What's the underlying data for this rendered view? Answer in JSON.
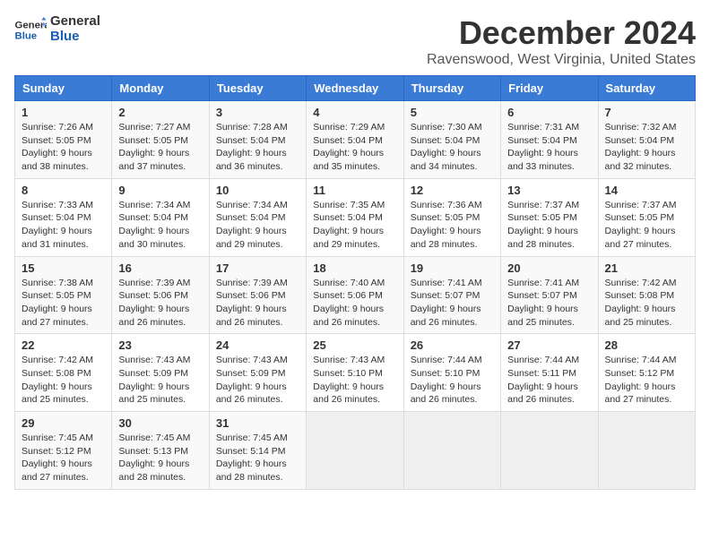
{
  "logo": {
    "line1": "General",
    "line2": "Blue"
  },
  "title": "December 2024",
  "location": "Ravenswood, West Virginia, United States",
  "days_of_week": [
    "Sunday",
    "Monday",
    "Tuesday",
    "Wednesday",
    "Thursday",
    "Friday",
    "Saturday"
  ],
  "weeks": [
    [
      {
        "day": "1",
        "sunrise": "Sunrise: 7:26 AM",
        "sunset": "Sunset: 5:05 PM",
        "daylight": "Daylight: 9 hours and 38 minutes."
      },
      {
        "day": "2",
        "sunrise": "Sunrise: 7:27 AM",
        "sunset": "Sunset: 5:05 PM",
        "daylight": "Daylight: 9 hours and 37 minutes."
      },
      {
        "day": "3",
        "sunrise": "Sunrise: 7:28 AM",
        "sunset": "Sunset: 5:04 PM",
        "daylight": "Daylight: 9 hours and 36 minutes."
      },
      {
        "day": "4",
        "sunrise": "Sunrise: 7:29 AM",
        "sunset": "Sunset: 5:04 PM",
        "daylight": "Daylight: 9 hours and 35 minutes."
      },
      {
        "day": "5",
        "sunrise": "Sunrise: 7:30 AM",
        "sunset": "Sunset: 5:04 PM",
        "daylight": "Daylight: 9 hours and 34 minutes."
      },
      {
        "day": "6",
        "sunrise": "Sunrise: 7:31 AM",
        "sunset": "Sunset: 5:04 PM",
        "daylight": "Daylight: 9 hours and 33 minutes."
      },
      {
        "day": "7",
        "sunrise": "Sunrise: 7:32 AM",
        "sunset": "Sunset: 5:04 PM",
        "daylight": "Daylight: 9 hours and 32 minutes."
      }
    ],
    [
      {
        "day": "8",
        "sunrise": "Sunrise: 7:33 AM",
        "sunset": "Sunset: 5:04 PM",
        "daylight": "Daylight: 9 hours and 31 minutes."
      },
      {
        "day": "9",
        "sunrise": "Sunrise: 7:34 AM",
        "sunset": "Sunset: 5:04 PM",
        "daylight": "Daylight: 9 hours and 30 minutes."
      },
      {
        "day": "10",
        "sunrise": "Sunrise: 7:34 AM",
        "sunset": "Sunset: 5:04 PM",
        "daylight": "Daylight: 9 hours and 29 minutes."
      },
      {
        "day": "11",
        "sunrise": "Sunrise: 7:35 AM",
        "sunset": "Sunset: 5:04 PM",
        "daylight": "Daylight: 9 hours and 29 minutes."
      },
      {
        "day": "12",
        "sunrise": "Sunrise: 7:36 AM",
        "sunset": "Sunset: 5:05 PM",
        "daylight": "Daylight: 9 hours and 28 minutes."
      },
      {
        "day": "13",
        "sunrise": "Sunrise: 7:37 AM",
        "sunset": "Sunset: 5:05 PM",
        "daylight": "Daylight: 9 hours and 28 minutes."
      },
      {
        "day": "14",
        "sunrise": "Sunrise: 7:37 AM",
        "sunset": "Sunset: 5:05 PM",
        "daylight": "Daylight: 9 hours and 27 minutes."
      }
    ],
    [
      {
        "day": "15",
        "sunrise": "Sunrise: 7:38 AM",
        "sunset": "Sunset: 5:05 PM",
        "daylight": "Daylight: 9 hours and 27 minutes."
      },
      {
        "day": "16",
        "sunrise": "Sunrise: 7:39 AM",
        "sunset": "Sunset: 5:06 PM",
        "daylight": "Daylight: 9 hours and 26 minutes."
      },
      {
        "day": "17",
        "sunrise": "Sunrise: 7:39 AM",
        "sunset": "Sunset: 5:06 PM",
        "daylight": "Daylight: 9 hours and 26 minutes."
      },
      {
        "day": "18",
        "sunrise": "Sunrise: 7:40 AM",
        "sunset": "Sunset: 5:06 PM",
        "daylight": "Daylight: 9 hours and 26 minutes."
      },
      {
        "day": "19",
        "sunrise": "Sunrise: 7:41 AM",
        "sunset": "Sunset: 5:07 PM",
        "daylight": "Daylight: 9 hours and 26 minutes."
      },
      {
        "day": "20",
        "sunrise": "Sunrise: 7:41 AM",
        "sunset": "Sunset: 5:07 PM",
        "daylight": "Daylight: 9 hours and 25 minutes."
      },
      {
        "day": "21",
        "sunrise": "Sunrise: 7:42 AM",
        "sunset": "Sunset: 5:08 PM",
        "daylight": "Daylight: 9 hours and 25 minutes."
      }
    ],
    [
      {
        "day": "22",
        "sunrise": "Sunrise: 7:42 AM",
        "sunset": "Sunset: 5:08 PM",
        "daylight": "Daylight: 9 hours and 25 minutes."
      },
      {
        "day": "23",
        "sunrise": "Sunrise: 7:43 AM",
        "sunset": "Sunset: 5:09 PM",
        "daylight": "Daylight: 9 hours and 25 minutes."
      },
      {
        "day": "24",
        "sunrise": "Sunrise: 7:43 AM",
        "sunset": "Sunset: 5:09 PM",
        "daylight": "Daylight: 9 hours and 26 minutes."
      },
      {
        "day": "25",
        "sunrise": "Sunrise: 7:43 AM",
        "sunset": "Sunset: 5:10 PM",
        "daylight": "Daylight: 9 hours and 26 minutes."
      },
      {
        "day": "26",
        "sunrise": "Sunrise: 7:44 AM",
        "sunset": "Sunset: 5:10 PM",
        "daylight": "Daylight: 9 hours and 26 minutes."
      },
      {
        "day": "27",
        "sunrise": "Sunrise: 7:44 AM",
        "sunset": "Sunset: 5:11 PM",
        "daylight": "Daylight: 9 hours and 26 minutes."
      },
      {
        "day": "28",
        "sunrise": "Sunrise: 7:44 AM",
        "sunset": "Sunset: 5:12 PM",
        "daylight": "Daylight: 9 hours and 27 minutes."
      }
    ],
    [
      {
        "day": "29",
        "sunrise": "Sunrise: 7:45 AM",
        "sunset": "Sunset: 5:12 PM",
        "daylight": "Daylight: 9 hours and 27 minutes."
      },
      {
        "day": "30",
        "sunrise": "Sunrise: 7:45 AM",
        "sunset": "Sunset: 5:13 PM",
        "daylight": "Daylight: 9 hours and 28 minutes."
      },
      {
        "day": "31",
        "sunrise": "Sunrise: 7:45 AM",
        "sunset": "Sunset: 5:14 PM",
        "daylight": "Daylight: 9 hours and 28 minutes."
      },
      null,
      null,
      null,
      null
    ]
  ]
}
